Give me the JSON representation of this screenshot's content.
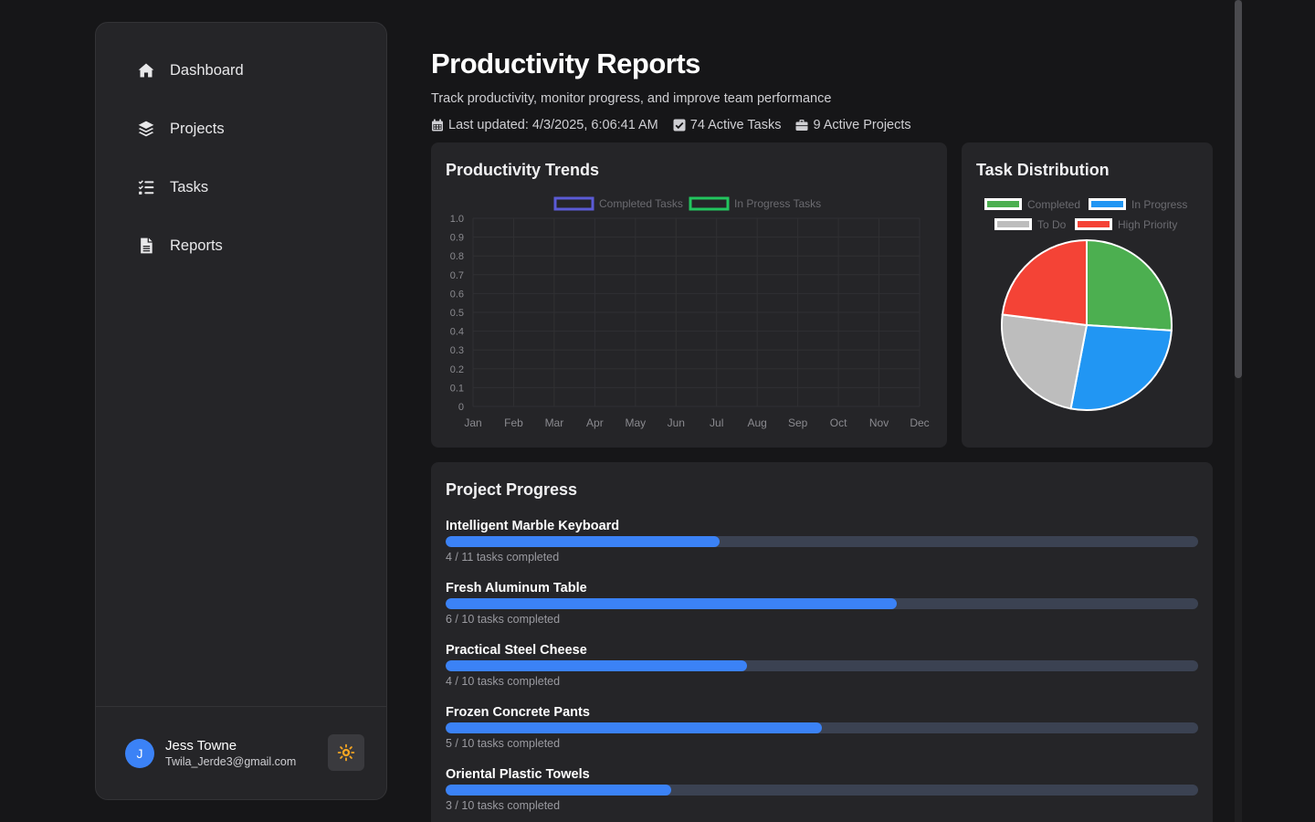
{
  "sidebar": {
    "items": [
      {
        "label": "Dashboard",
        "icon": "home-icon"
      },
      {
        "label": "Projects",
        "icon": "layers-icon"
      },
      {
        "label": "Tasks",
        "icon": "task-list-icon"
      },
      {
        "label": "Reports",
        "icon": "document-icon"
      }
    ],
    "user": {
      "initial": "J",
      "name": "Jess Towne",
      "email": "Twila_Jerde3@gmail.com"
    },
    "theme_toggle_icon": "sun-icon"
  },
  "header": {
    "title": "Productivity Reports",
    "subtitle": "Track productivity, monitor progress, and improve team performance",
    "last_updated": "Last updated: 4/3/2025, 6:06:41 AM",
    "active_tasks": "74 Active Tasks",
    "active_projects": "9 Active Projects"
  },
  "trends": {
    "title": "Productivity Trends"
  },
  "distribution": {
    "title": "Task Distribution"
  },
  "progress": {
    "title": "Project Progress",
    "projects": [
      {
        "name": "Intelligent Marble Keyboard",
        "completed": 4,
        "total": 11,
        "label": "4 / 11 tasks completed"
      },
      {
        "name": "Fresh Aluminum Table",
        "completed": 6,
        "total": 10,
        "label": "6 / 10 tasks completed"
      },
      {
        "name": "Practical Steel Cheese",
        "completed": 4,
        "total": 10,
        "label": "4 / 10 tasks completed"
      },
      {
        "name": "Frozen Concrete Pants",
        "completed": 5,
        "total": 10,
        "label": "5 / 10 tasks completed"
      },
      {
        "name": "Oriental Plastic Towels",
        "completed": 3,
        "total": 10,
        "label": "3 / 10 tasks completed"
      }
    ]
  },
  "colors": {
    "accent": "#3b82f6",
    "completed": "#4caf50",
    "in_progress": "#2196f3",
    "to_do": "#bdbdbd",
    "high_priority": "#f44336",
    "line_completed": "#5b5bd6",
    "line_in_progress": "#22c55e"
  },
  "chart_data": [
    {
      "type": "line",
      "categories": [
        "Jan",
        "Feb",
        "Mar",
        "Apr",
        "May",
        "Jun",
        "Jul",
        "Aug",
        "Sep",
        "Oct",
        "Nov",
        "Dec"
      ],
      "y_ticks": [
        "0",
        "0.1",
        "0.2",
        "0.3",
        "0.4",
        "0.5",
        "0.6",
        "0.7",
        "0.8",
        "0.9",
        "1.0"
      ],
      "ylim": [
        0,
        1
      ],
      "series": [
        {
          "name": "Completed Tasks",
          "values": []
        },
        {
          "name": "In Progress Tasks",
          "values": []
        }
      ],
      "grid": true,
      "legend": "top"
    },
    {
      "type": "pie",
      "categories": [
        "Completed",
        "In Progress",
        "To Do",
        "High Priority"
      ],
      "values": [
        26,
        27,
        24,
        23
      ],
      "legend": "top"
    }
  ]
}
